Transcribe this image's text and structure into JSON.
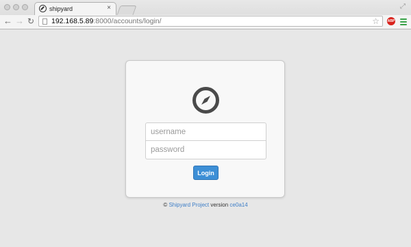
{
  "browser": {
    "tab_title": "shipyard",
    "tab_close": "×",
    "url_host": "192.168.5.89",
    "url_rest": ":8000/accounts/login/",
    "abp_label": "ABP",
    "icons": {
      "back": "back-arrow-icon",
      "forward": "forward-arrow-icon",
      "reload": "reload-icon",
      "bookmark": "star-icon",
      "menu": "hamburger-menu-icon"
    }
  },
  "login": {
    "logo_icon": "compass-icon",
    "username_placeholder": "username",
    "password_placeholder": "password",
    "submit_label": "Login"
  },
  "footer": {
    "copyright_symbol": "©",
    "project_link": "Shipyard Project",
    "version_word": "version",
    "version_link": "ce0a14"
  },
  "colors": {
    "accent": "#3d8fd6",
    "link": "#3d7ec7",
    "background": "#e7e7e7"
  }
}
